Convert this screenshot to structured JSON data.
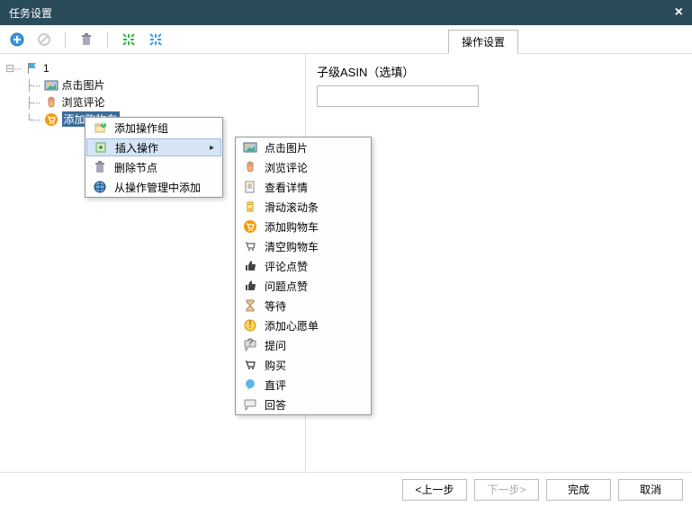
{
  "window": {
    "title": "任务设置"
  },
  "toolbar_icons": [
    "add-icon",
    "forbid-icon",
    "trash-icon",
    "expand-green-icon",
    "expand-blue-icon"
  ],
  "tree": {
    "root": "1",
    "nodes": [
      {
        "label": "点击图片",
        "icon": "image-icon"
      },
      {
        "label": "浏览评论",
        "icon": "hand-icon"
      },
      {
        "label": "添加购物车",
        "icon": "cart-orange-icon",
        "selected": true
      }
    ]
  },
  "context_menu": {
    "items": [
      {
        "label": "添加操作组",
        "icon": "group-add-icon"
      },
      {
        "label": "插入操作",
        "icon": "insert-icon",
        "has_submenu": true,
        "highlight": true
      },
      {
        "label": "删除节点",
        "icon": "trash-icon"
      },
      {
        "label": "从操作管理中添加",
        "icon": "globe-icon"
      }
    ],
    "submenu": [
      {
        "label": "点击图片",
        "icon": "image-icon"
      },
      {
        "label": "浏览评论",
        "icon": "hand-icon"
      },
      {
        "label": "查看详情",
        "icon": "detail-icon"
      },
      {
        "label": "滑动滚动条",
        "icon": "scroll-icon"
      },
      {
        "label": "添加购物车",
        "icon": "cart-orange-icon"
      },
      {
        "label": "清空购物车",
        "icon": "cart-empty-icon"
      },
      {
        "label": "评论点赞",
        "icon": "thumb-icon"
      },
      {
        "label": "问题点赞",
        "icon": "thumb-icon"
      },
      {
        "label": "等待",
        "icon": "hourglass-icon"
      },
      {
        "label": "添加心愿单",
        "icon": "wish-icon"
      },
      {
        "label": "提问",
        "icon": "question-icon"
      },
      {
        "label": "购买",
        "icon": "buy-icon"
      },
      {
        "label": "直评",
        "icon": "comment-icon"
      },
      {
        "label": "回答",
        "icon": "answer-icon"
      }
    ]
  },
  "right": {
    "tab_label": "操作设置",
    "field_label": "子级ASIN（选填）",
    "field_value": ""
  },
  "footer": {
    "prev": "<上一步",
    "next": "下一步>",
    "finish": "完成",
    "cancel": "取消"
  }
}
